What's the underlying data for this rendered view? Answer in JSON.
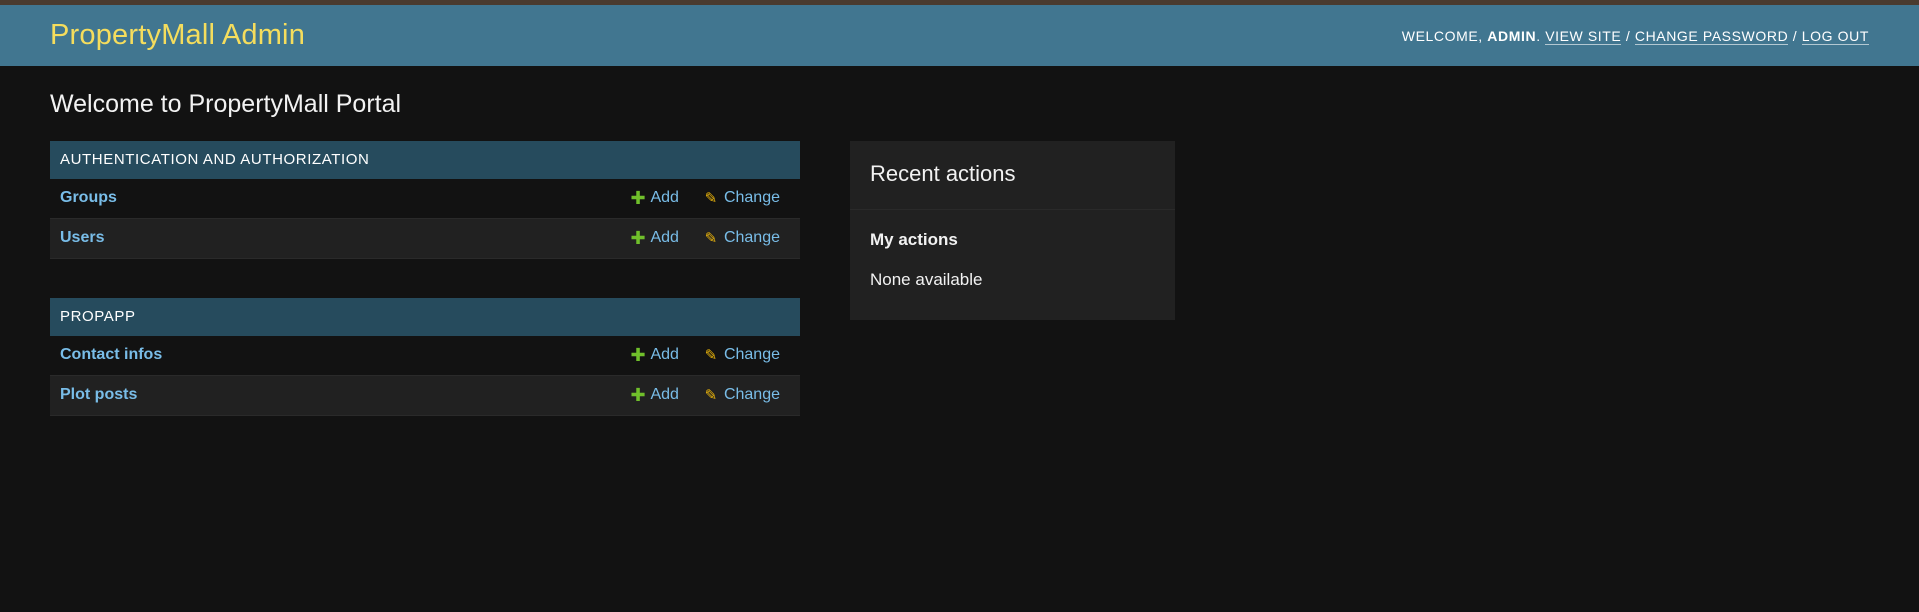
{
  "header": {
    "site_name": "PropertyMall Admin",
    "welcome_prefix": "WELCOME,",
    "username": "ADMIN",
    "view_site": "VIEW SITE",
    "change_password": "CHANGE PASSWORD",
    "log_out": "LOG OUT"
  },
  "page": {
    "title": "Welcome to PropertyMall Portal"
  },
  "modules": [
    {
      "caption": "AUTHENTICATION AND AUTHORIZATION",
      "rows": [
        {
          "name": "Groups",
          "add": "Add",
          "change": "Change"
        },
        {
          "name": "Users",
          "add": "Add",
          "change": "Change"
        }
      ]
    },
    {
      "caption": "PROPAPP",
      "rows": [
        {
          "name": "Contact infos",
          "add": "Add",
          "change": "Change"
        },
        {
          "name": "Plot posts",
          "add": "Add",
          "change": "Change"
        }
      ]
    }
  ],
  "recent": {
    "title": "Recent actions",
    "subtitle": "My actions",
    "empty": "None available"
  },
  "colors": {
    "header_bg": "#417690",
    "site_name": "#f5dd5d",
    "module_caption_bg": "#264b5d",
    "link": "#79bde8",
    "add_icon": "#70bf2b",
    "change_icon": "#efb80b",
    "body_bg": "#121212"
  },
  "icons": {
    "add": "plus-icon",
    "change": "pencil-icon"
  }
}
